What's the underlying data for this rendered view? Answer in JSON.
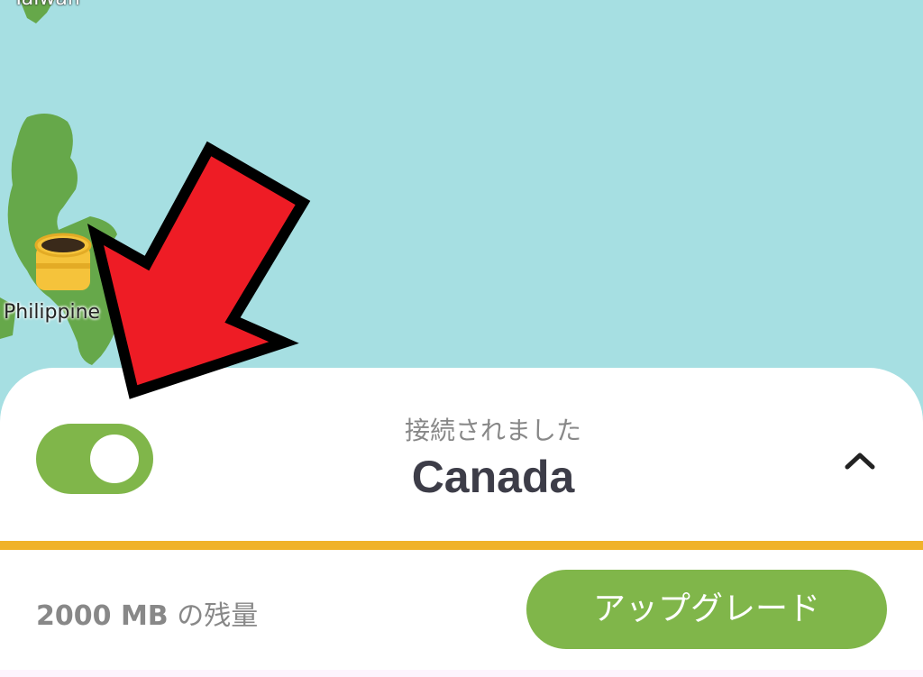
{
  "map": {
    "label_taiwan": "Taiwan",
    "label_philippines": "Philippine",
    "server_marker_icon": "server-pot-icon",
    "water_color": "#a6dfe2",
    "land_color": "#66a84a"
  },
  "connection": {
    "status": "接続されました",
    "country": "Canada",
    "toggle_on": true,
    "expand_icon": "chevron-up-icon",
    "data_usage_fraction": 1.0
  },
  "footer": {
    "data_amount": "2000 MB",
    "data_suffix": " の残量",
    "upgrade_label": "アップグレード"
  },
  "annotation": {
    "arrow_icon": "red-arrow-icon",
    "arrow_color": "#ee1c25"
  },
  "colors": {
    "accent_green": "#80b64a",
    "progress_yellow": "#f0b229"
  }
}
